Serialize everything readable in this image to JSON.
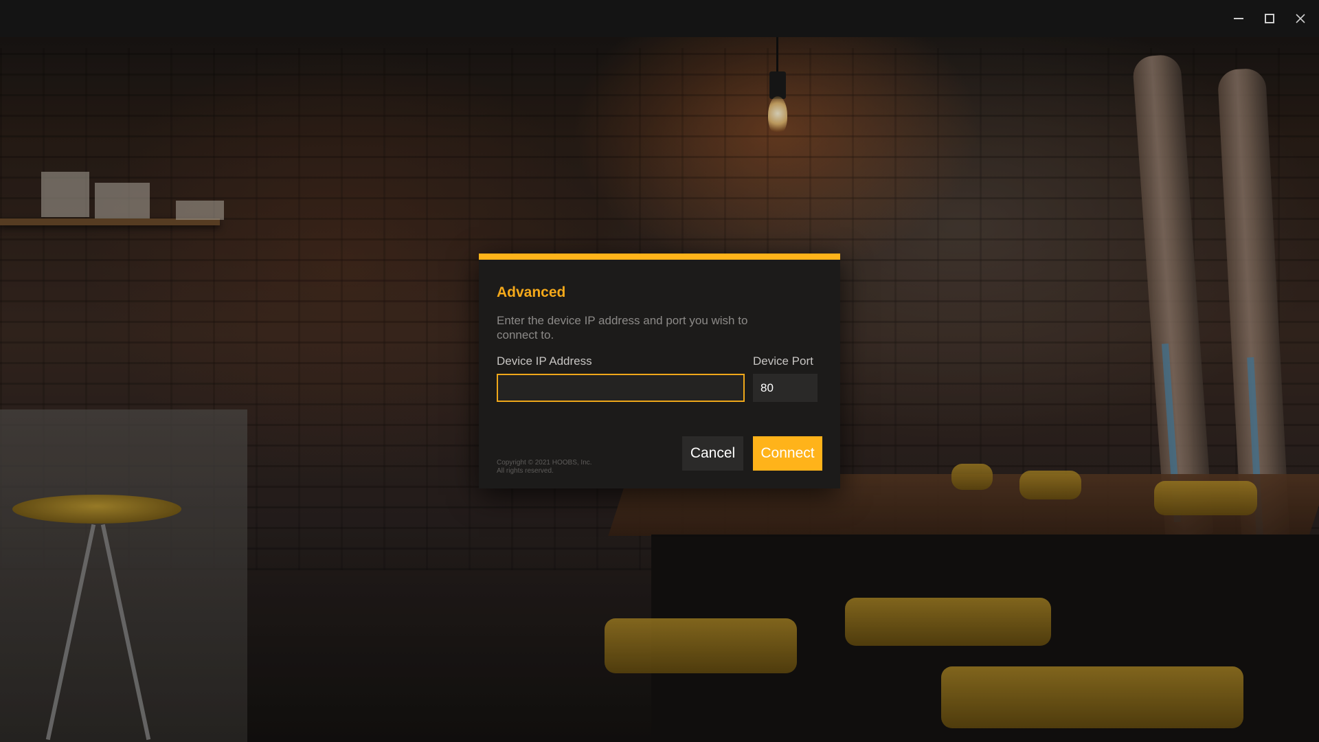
{
  "window": {
    "controls": {
      "minimize_icon": "minimize-icon",
      "maximize_icon": "maximize-icon",
      "close_icon": "close-icon"
    }
  },
  "dialog": {
    "title": "Advanced",
    "description": "Enter the device IP address and port you wish to connect to.",
    "ip_label": "Device IP Address",
    "ip_value": "",
    "port_label": "Device Port",
    "port_value": "80",
    "copyright_line1": "Copyright © 2021 HOOBS, Inc.",
    "copyright_line2": "All rights reserved.",
    "cancel_label": "Cancel",
    "connect_label": "Connect"
  },
  "colors": {
    "accent": "#ffb31a",
    "title": "#f5a91a",
    "dialog_bg": "#1c1b1a",
    "titlebar_bg": "#141414"
  }
}
